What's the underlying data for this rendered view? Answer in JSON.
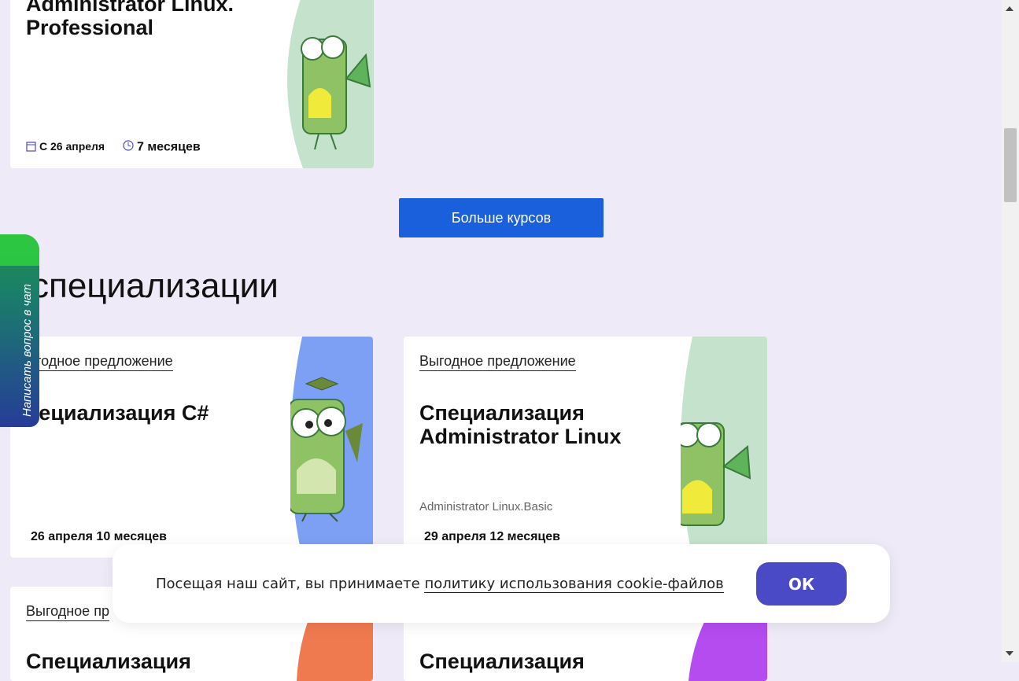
{
  "top_card": {
    "title": "Administrator Linux.\nProfessional",
    "start_date": "С 26 апреля",
    "duration": "7 месяцев",
    "art_color": "#c5e3cc"
  },
  "more_button": {
    "label": "Больше курсов"
  },
  "section": {
    "title": "специализации"
  },
  "chat": {
    "label": "Написать вопрос в чат"
  },
  "cards": [
    {
      "badge": "ыгодное предложение",
      "title": "пециализация C#",
      "subtitle": "",
      "meta": "26 апреля 10 месяцев",
      "art_color": "#7da0f5"
    },
    {
      "badge": "Выгодное предложение",
      "title": "Специализация\nAdministrator Linux",
      "subtitle": "Administrator Linux.Basic",
      "meta": "29 апреля 12 месяцев",
      "art_color": "#c5e3cc"
    },
    {
      "badge": "Выгодное пр",
      "title": "Специализация",
      "art_color": "#f07a50"
    },
    {
      "badge": "",
      "title": "Специализация",
      "art_color": "#b44cf0"
    }
  ],
  "cookie": {
    "text": "Посещая наш сайт, вы принимаете ",
    "link": "политику использования cookie-файлов",
    "ok_label": "ОК"
  },
  "colors": {
    "background": "#eeeaf7",
    "primary_button": "#1a5fdc",
    "ok_button": "#4a49c6"
  }
}
